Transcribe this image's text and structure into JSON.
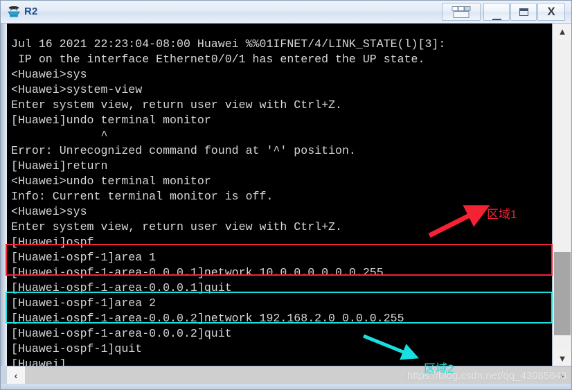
{
  "window": {
    "title": "R2",
    "icon": "router-icon",
    "buttons": {
      "restore_group_label": "",
      "minimize_label": "",
      "maximize_label": "",
      "close_label": "X"
    }
  },
  "terminal": {
    "lines": [
      "Jul 16 2021 22:23:04-08:00 Huawei %%01IFNET/4/LINK_STATE(l)[3]:",
      " IP on the interface Ethernet0/0/1 has entered the UP state.",
      "<Huawei>sys",
      "<Huawei>system-view",
      "Enter system view, return user view with Ctrl+Z.",
      "[Huawei]undo terminal monitor",
      "             ^",
      "Error: Unrecognized command found at '^' position.",
      "[Huawei]return",
      "<Huawei>undo terminal monitor",
      "Info: Current terminal monitor is off.",
      "<Huawei>sys",
      "Enter system view, return user view with Ctrl+Z.",
      "[Huawei]ospf",
      "[Huawei-ospf-1]area 1",
      "[Huawei-ospf-1-area-0.0.0.1]network 10.0.0.0 0.0.0.255",
      "[Huawei-ospf-1-area-0.0.0.1]quit",
      "[Huawei-ospf-1]area 2",
      "[Huawei-ospf-1-area-0.0.0.2]network 192.168.2.0 0.0.0.255",
      "[Huawei-ospf-1-area-0.0.0.2]quit",
      "[Huawei-ospf-1]quit",
      "[Huawei]"
    ]
  },
  "annotations": {
    "area1": {
      "label": "区域1",
      "color": "#f32235"
    },
    "area2": {
      "label": "区域2",
      "color": "#19e0e0"
    }
  },
  "scrollbars": {
    "vertical_up": "▲",
    "vertical_down": "▼",
    "horizontal_left": "‹",
    "horizontal_right": "›"
  },
  "watermark": {
    "text": "https://blog.csdn.net/qq_43085848"
  }
}
